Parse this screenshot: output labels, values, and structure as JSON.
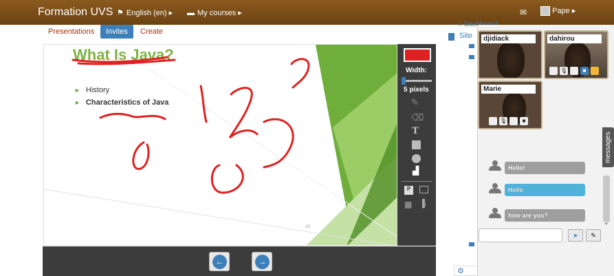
{
  "topbar": {
    "brand": "Formation UVS",
    "language": "English (en)",
    "courses": "My courses",
    "user": "Pape",
    "mail_icon": "envelope-icon",
    "flag_icon": "flag-icon",
    "courses_icon": "book-icon"
  },
  "tabs": [
    {
      "label": "Presentations"
    },
    {
      "label": "Invites"
    },
    {
      "label": "Create"
    }
  ],
  "slide": {
    "title": "What Is Java?",
    "bullets": [
      "History",
      "Characteristics of Java"
    ],
    "footer_number": "10"
  },
  "toolbar": {
    "color": "#e02020",
    "width_label": "Width:",
    "width_value": "5 pixels",
    "tools": [
      "pencil-icon",
      "eraser-icon",
      "text-icon",
      "rectangle-icon",
      "circle-icon",
      "trash-icon"
    ]
  },
  "sidenav": {
    "dashboard": "Dashboard",
    "site": "Site"
  },
  "videos": [
    {
      "name": "djidiack"
    },
    {
      "name": "dahirou"
    },
    {
      "name": "Marie"
    }
  ],
  "messages": [
    {
      "text": "Hello!",
      "color": "#9e9e9e"
    },
    {
      "text": "Hello",
      "color": "#4fb3d9"
    },
    {
      "text": "how are you?",
      "color": "#9e9e9e"
    }
  ],
  "messages_tab": "messages",
  "colors": {
    "topbar": "#7a4f18",
    "accent": "#3d7fb8",
    "slide_green": "#7cb342",
    "annotation_red": "#e02020"
  }
}
